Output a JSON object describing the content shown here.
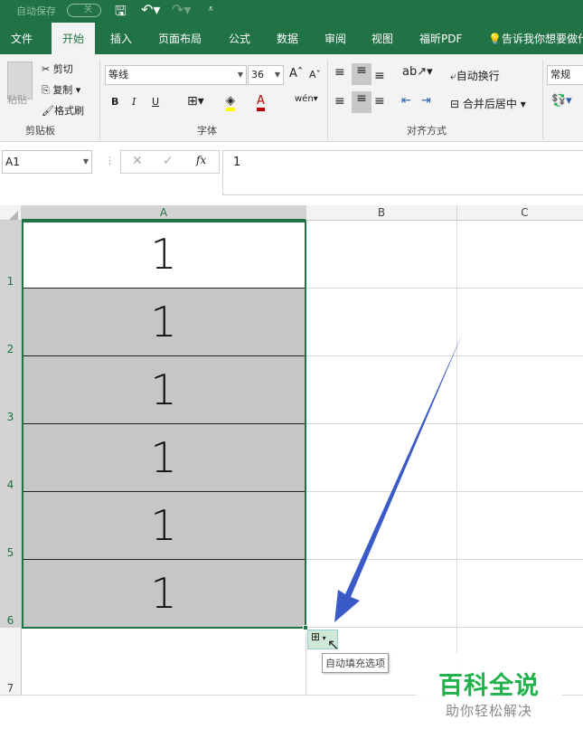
{
  "titlebar": {
    "autosave_label": "自动保存",
    "autosave_state": "关",
    "icons": [
      "save-icon",
      "undo-icon",
      "redo-icon",
      "customize-icon"
    ]
  },
  "tabs": [
    {
      "label": "文件"
    },
    {
      "label": "开始",
      "active": true
    },
    {
      "label": "插入"
    },
    {
      "label": "页面布局"
    },
    {
      "label": "公式"
    },
    {
      "label": "数据"
    },
    {
      "label": "审阅"
    },
    {
      "label": "视图"
    },
    {
      "label": "福昕PDF"
    }
  ],
  "tell_me": "告诉我你想要做什么",
  "ribbon": {
    "clipboard": {
      "paste": "粘贴",
      "cut": "剪切",
      "copy": "复制",
      "format_painter": "格式刷",
      "group": "剪贴板"
    },
    "font": {
      "name": "等线",
      "size": "36",
      "bold": "B",
      "italic": "I",
      "underline": "U",
      "group": "字体",
      "highlight_color": "#ffff00",
      "font_color": "#c00000"
    },
    "alignment": {
      "wrap": "自动换行",
      "merge": "合并后居中",
      "group": "对齐方式"
    },
    "number": {
      "format": "常规"
    }
  },
  "formula_bar": {
    "name_box": "A1",
    "fx": "fx",
    "value": "1"
  },
  "columns": [
    "A",
    "B",
    "C"
  ],
  "rows": [
    {
      "num": "1",
      "a": "1"
    },
    {
      "num": "2",
      "a": "1"
    },
    {
      "num": "3",
      "a": "1"
    },
    {
      "num": "4",
      "a": "1"
    },
    {
      "num": "5",
      "a": "1"
    },
    {
      "num": "6",
      "a": "1"
    },
    {
      "num": "7",
      "a": ""
    }
  ],
  "autofill_tooltip": "自动填充选项",
  "watermark": {
    "title": "百科全说",
    "subtitle": "助你轻松解决"
  },
  "colors": {
    "brand": "#217346",
    "arrow": "#3a5bc7",
    "selection": "#c6c6c6",
    "watermark": "#22b24c"
  }
}
